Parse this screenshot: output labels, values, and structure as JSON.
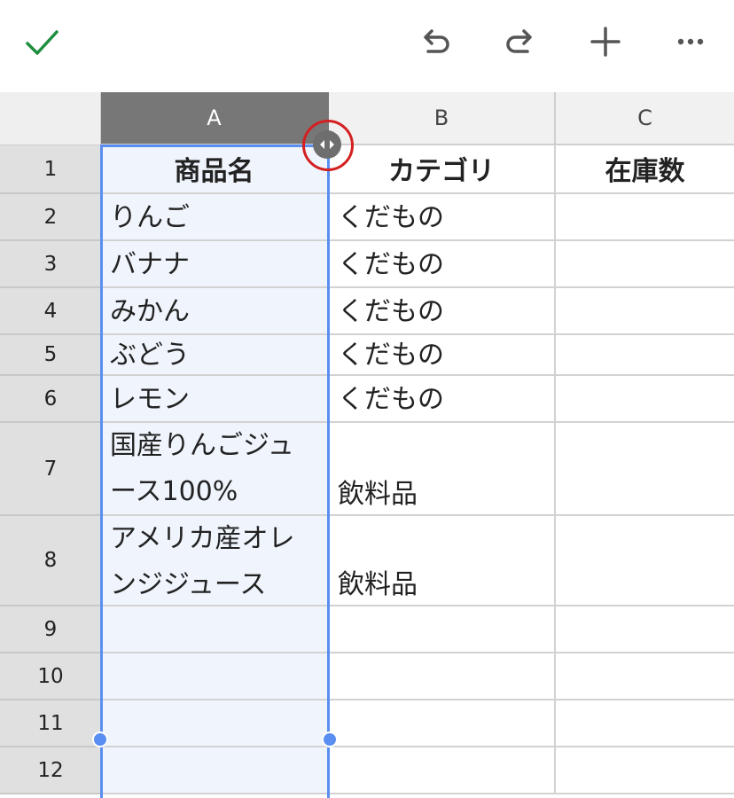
{
  "toolbar": {
    "icons": [
      "check-icon",
      "undo-icon",
      "redo-icon",
      "plus-icon",
      "more-icon"
    ],
    "accent_green": "#1e8e3e"
  },
  "sheet": {
    "columns": [
      {
        "label": "A",
        "selected": true
      },
      {
        "label": "B",
        "selected": false
      },
      {
        "label": "C",
        "selected": false
      }
    ],
    "row_numbers": [
      "1",
      "2",
      "3",
      "4",
      "5",
      "6",
      "7",
      "8",
      "9",
      "10",
      "11",
      "12"
    ],
    "rows": [
      {
        "a": "商品名",
        "b": "カテゴリ",
        "c": "在庫数",
        "header": true
      },
      {
        "a": "りんご",
        "b": "くだもの",
        "c": ""
      },
      {
        "a": "バナナ",
        "b": "くだもの",
        "c": ""
      },
      {
        "a": "みかん",
        "b": "くだもの",
        "c": ""
      },
      {
        "a": "ぶどう",
        "b": "くだもの",
        "c": ""
      },
      {
        "a": "レモン",
        "b": "くだもの",
        "c": ""
      },
      {
        "a": "国産りんごジュース100%",
        "a_lines": [
          "国産りんごジュ",
          "ース100%"
        ],
        "b": "飲料品",
        "c": ""
      },
      {
        "a": "アメリカ産オレンジジュース",
        "a_lines": [
          "アメリカ産オレ",
          "ンジジュース"
        ],
        "b": "飲料品",
        "c": ""
      },
      {
        "a": "",
        "b": "",
        "c": ""
      },
      {
        "a": "",
        "b": "",
        "c": ""
      },
      {
        "a": "",
        "b": "",
        "c": ""
      },
      {
        "a": "",
        "b": "",
        "c": ""
      }
    ],
    "selection_color": "#5a8ef0",
    "highlight_ring_color": "#d42020"
  }
}
